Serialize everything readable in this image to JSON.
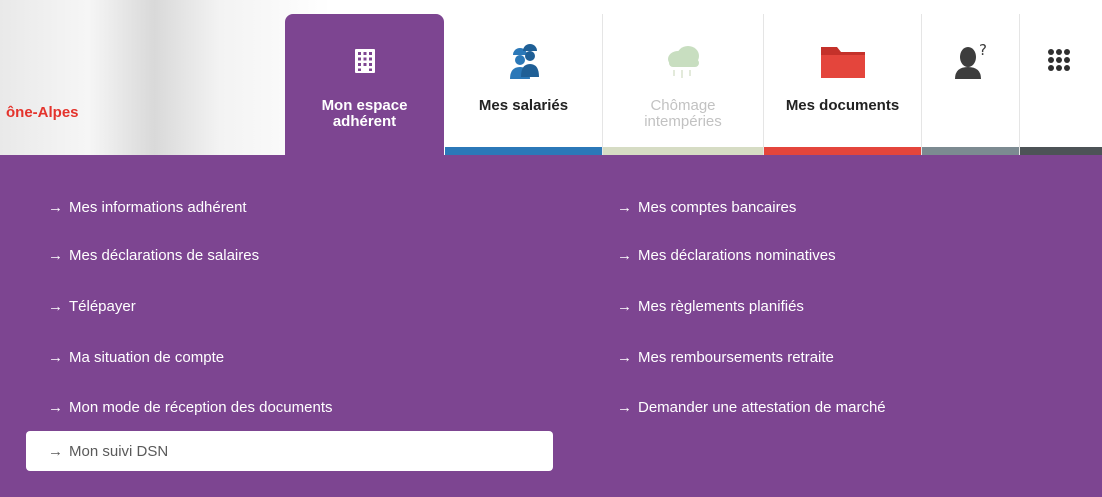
{
  "header": {
    "brand": "ône-Alpes",
    "tabs": [
      {
        "id": "espace",
        "label_line1": "Mon espace",
        "label_line2": "adhérent",
        "icon": "grid-building-icon",
        "active": true
      },
      {
        "id": "salaries",
        "label": "Mes salariés",
        "icon": "workers-helmet-icon",
        "bar_color": "#2b78b8"
      },
      {
        "id": "chomage",
        "label_line1": "Chômage",
        "label_line2": "intempéries",
        "icon": "rain-cloud-icon",
        "disabled": true,
        "bar_color": "#d6dcc4"
      },
      {
        "id": "documents",
        "label": "Mes documents",
        "icon": "folder-icon",
        "bar_color": "#e4453c"
      },
      {
        "id": "help",
        "icon": "user-question-icon",
        "bar_color": "#7c8a91"
      },
      {
        "id": "apps",
        "icon": "apps-grid-icon",
        "bar_color": "#4d5357"
      }
    ]
  },
  "menu": {
    "arrow": "→",
    "left": [
      "Mes informations adhérent",
      "Mes déclarations de salaires",
      "Télépayer",
      "Ma situation de compte",
      "Mon mode de réception des documents",
      "Mon suivi DSN"
    ],
    "right": [
      "Mes comptes bancaires",
      "Mes déclarations nominatives",
      "Mes règlements planifiés",
      "Mes remboursements retraite",
      "Demander une attestation de marché"
    ],
    "selected": "Mon suivi DSN"
  },
  "colors": {
    "purple": "#7d4591",
    "brand_red": "#e4332c"
  }
}
